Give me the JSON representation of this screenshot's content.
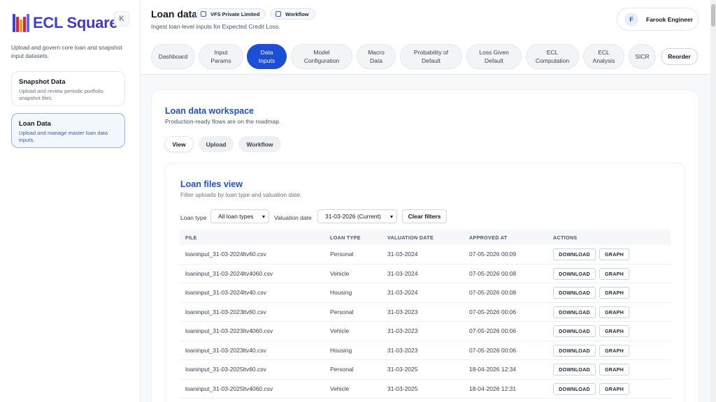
{
  "sidebar": {
    "logo_text_left": "ECL",
    "logo_text_right": "Square",
    "collapse_label": "K",
    "description": "Upload and govern core loan and snapshot input datasets.",
    "cards": [
      {
        "title": "Snapshot Data",
        "desc": "Upload and review periodic portfolio snapshot files."
      },
      {
        "title": "Loan Data",
        "desc": "Upload and manage master loan data inputs."
      }
    ]
  },
  "header": {
    "title": "Loan data",
    "chip_company": "VFS Private Limited",
    "chip_workflow": "Workflow",
    "subtitle": "Ingest loan-level inputs for Expected Credit Loss.",
    "user_initial": "F",
    "user_name": "Farook Engineer"
  },
  "tabs": [
    {
      "line1": "Dashboard",
      "line2": ""
    },
    {
      "line1": "Input",
      "line2": "Params"
    },
    {
      "line1": "Data",
      "line2": "Inputs"
    },
    {
      "line1": "Model",
      "line2": "Configuration"
    },
    {
      "line1": "Macro",
      "line2": "Data"
    },
    {
      "line1": "Probability of",
      "line2": "Default"
    },
    {
      "line1": "Loss Given",
      "line2": "Default"
    },
    {
      "line1": "ECL",
      "line2": "Computation"
    },
    {
      "line1": "ECL",
      "line2": "Analysis"
    },
    {
      "line1": "SICR",
      "line2": ""
    }
  ],
  "reorder_label": "Reorder",
  "workspace": {
    "title": "Loan data workspace",
    "subtitle": "Production-ready flows are on the roadmap.",
    "pills": [
      "View",
      "Upload",
      "Workflow"
    ]
  },
  "files_view": {
    "title": "Loan files view",
    "subtitle": "Filter uploads by loan type and valuation date.",
    "loan_type_label": "Loan type",
    "loan_type_value": "All loan types",
    "valuation_label": "Valuation date",
    "valuation_value": "31-03-2026 (Current)",
    "clear_label": "Clear filters",
    "columns": [
      "FILE",
      "LOAN TYPE",
      "VALUATION DATE",
      "APPROVED AT",
      "ACTIONS"
    ],
    "download_label": "DOWNLOAD",
    "graph_label": "GRAPH",
    "rows": [
      {
        "file": "loaninput_31-03-2024ltv60.csv",
        "type": "Personal",
        "date": "31-03-2024",
        "approved": "07-05-2026 00:09"
      },
      {
        "file": "loaninput_31-03-2024ltv4060.csv",
        "type": "Vehicle",
        "date": "31-03-2024",
        "approved": "07-05-2026 00:08"
      },
      {
        "file": "loaninput_31-03-2024ltv40.csv",
        "type": "Housing",
        "date": "31-03-2024",
        "approved": "07-05-2026 00:08"
      },
      {
        "file": "loaninput_31-03-2023ltv60.csv",
        "type": "Personal",
        "date": "31-03-2023",
        "approved": "07-05-2026 00:06"
      },
      {
        "file": "loaninput_31-03-2023ltv4060.csv",
        "type": "Vehicle",
        "date": "31-03-2023",
        "approved": "07-05-2026 00:06"
      },
      {
        "file": "loaninput_31-03-2023ltv40.csv",
        "type": "Housing",
        "date": "31-03-2023",
        "approved": "07-05-2026 00:06"
      },
      {
        "file": "loaninput_31-03-2025ltv60.csv",
        "type": "Personal",
        "date": "31-03-2025",
        "approved": "18-04-2026 12:34"
      },
      {
        "file": "loaninput_31-03-2025ltv4060.csv",
        "type": "Vehicle",
        "date": "31-03-2025",
        "approved": "18-04-2026 12:31"
      }
    ]
  },
  "colors": {
    "accent": "#1d4ed8",
    "logo_bars": [
      "#3b3fd6",
      "#e11d48",
      "#f59e0b",
      "#10b981",
      "#6366f1"
    ]
  }
}
